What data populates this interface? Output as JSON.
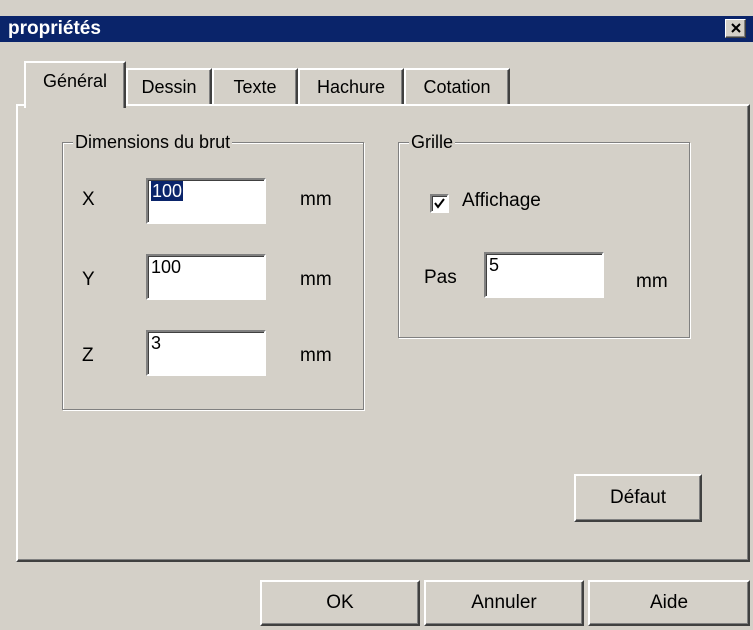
{
  "window": {
    "title": "propriétés",
    "close_icon": "close-x-icon",
    "title_bar_color": "#0a246a",
    "face_color": "#d4d0c8",
    "selection_color": "#0a246a"
  },
  "tabs": [
    {
      "label": "Général",
      "active": true
    },
    {
      "label": "Dessin",
      "active": false
    },
    {
      "label": "Texte",
      "active": false
    },
    {
      "label": "Hachure",
      "active": false
    },
    {
      "label": "Cotation",
      "active": false
    }
  ],
  "dimensions_group": {
    "legend": "Dimensions du brut",
    "fields": [
      {
        "label": "X",
        "value": "100",
        "unit": "mm",
        "selected": true
      },
      {
        "label": "Y",
        "value": "100",
        "unit": "mm",
        "selected": false
      },
      {
        "label": "Z",
        "value": "3",
        "unit": "mm",
        "selected": false
      }
    ]
  },
  "grid_group": {
    "legend": "Grille",
    "display_checkbox": {
      "label": "Affichage",
      "checked": true,
      "icon": "checkmark-icon"
    },
    "step_label": "Pas",
    "step_value": "5",
    "step_unit": "mm"
  },
  "buttons": {
    "default": "Défaut",
    "ok": "OK",
    "cancel": "Annuler",
    "help": "Aide"
  }
}
